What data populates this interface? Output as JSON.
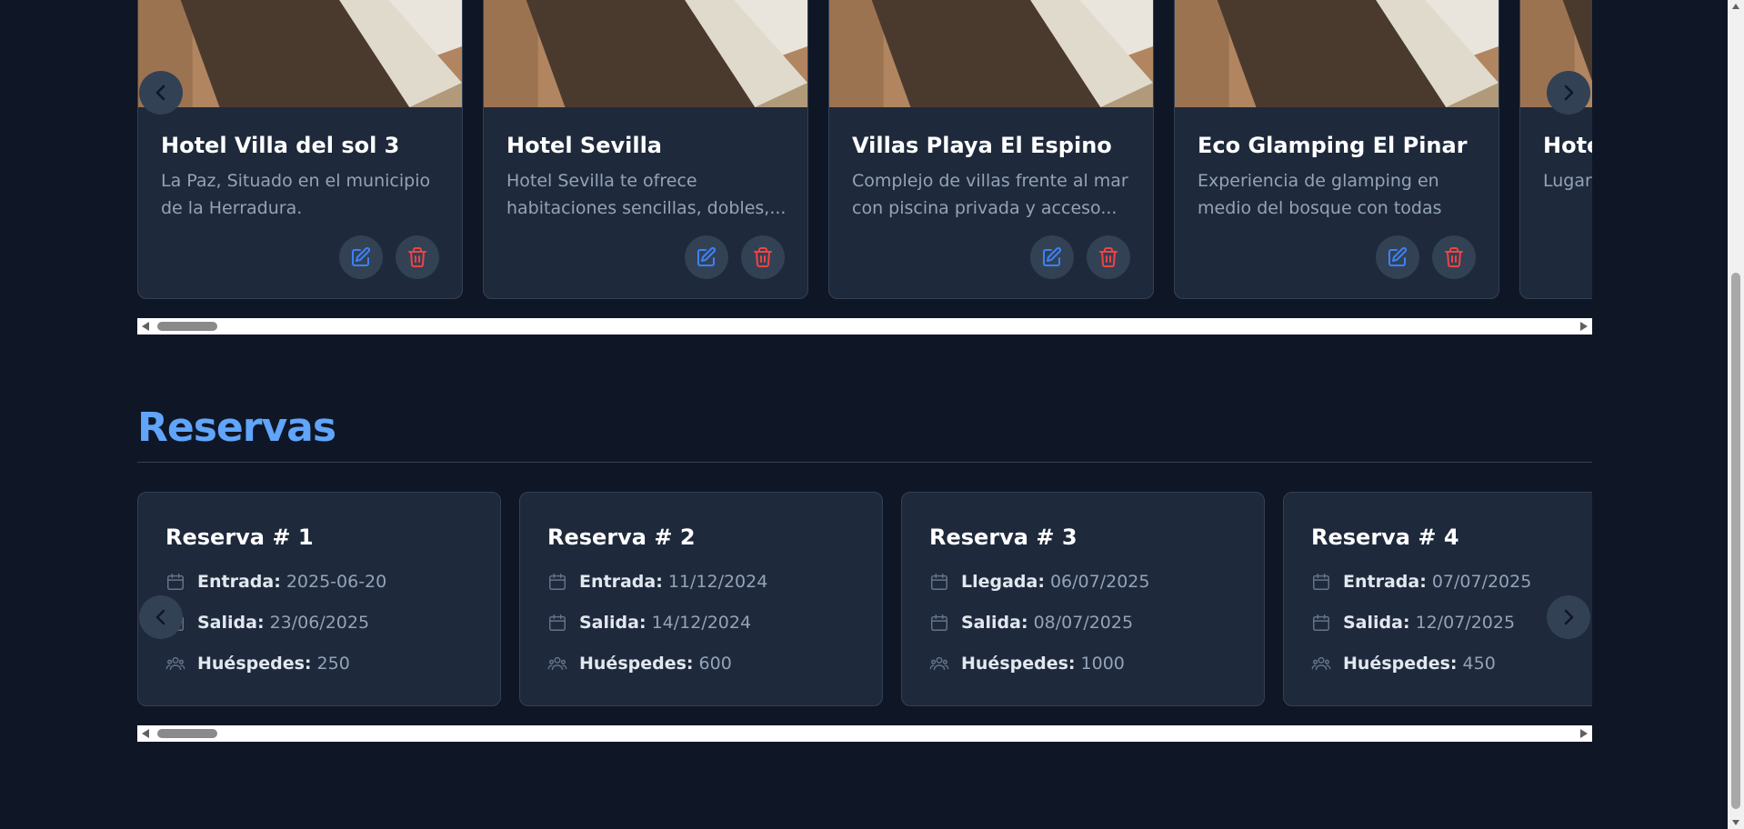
{
  "hotels": [
    {
      "name": "Hotel Villa del sol 3",
      "description": "La Paz, Situado en el municipio de la Herradura."
    },
    {
      "name": "Hotel Sevilla",
      "description": "Hotel Sevilla te ofrece habitaciones sencillas, dobles,..."
    },
    {
      "name": "Villas Playa El Espino",
      "description": "Complejo de villas frente al mar con piscina privada y acceso..."
    },
    {
      "name": "Eco Glamping El Pinar",
      "description": "Experiencia de glamping en medio del bosque con todas las..."
    },
    {
      "name": "Hotel",
      "description": "Lugar agradable"
    }
  ],
  "reservas": {
    "title": "Reservas",
    "items": [
      {
        "title": "Reserva # 1",
        "rows": [
          {
            "label": "Entrada:",
            "value": "2025-06-20",
            "icon": "calendar-icon"
          },
          {
            "label": "Salida:",
            "value": "23/06/2025",
            "icon": "calendar-icon"
          },
          {
            "label": "Huéspedes:",
            "value": "250",
            "icon": "users-icon"
          }
        ]
      },
      {
        "title": "Reserva # 2",
        "rows": [
          {
            "label": "Entrada:",
            "value": "11/12/2024",
            "icon": "calendar-icon"
          },
          {
            "label": "Salida:",
            "value": "14/12/2024",
            "icon": "calendar-icon"
          },
          {
            "label": "Huéspedes:",
            "value": "600",
            "icon": "users-icon"
          }
        ]
      },
      {
        "title": "Reserva # 3",
        "rows": [
          {
            "label": "Llegada:",
            "value": "06/07/2025",
            "icon": "calendar-icon"
          },
          {
            "label": "Salida:",
            "value": "08/07/2025",
            "icon": "calendar-icon"
          },
          {
            "label": "Huéspedes:",
            "value": "1000",
            "icon": "users-icon"
          }
        ]
      },
      {
        "title": "Reserva # 4",
        "rows": [
          {
            "label": "Entrada:",
            "value": "07/07/2025",
            "icon": "calendar-icon"
          },
          {
            "label": "Salida:",
            "value": "12/07/2025",
            "icon": "calendar-icon"
          },
          {
            "label": "Huéspedes:",
            "value": "450",
            "icon": "users-icon"
          }
        ]
      }
    ]
  },
  "colors": {
    "background": "#0f1626",
    "card": "#1e293b",
    "border": "#334155",
    "accent": "#60a5fa",
    "edit": "#3b82f6",
    "delete": "#ef4444",
    "muted": "#94a3b8"
  },
  "icons": [
    "pencil-square-icon",
    "trash-icon",
    "chevron-left-icon",
    "chevron-right-icon",
    "calendar-icon",
    "users-icon"
  ]
}
